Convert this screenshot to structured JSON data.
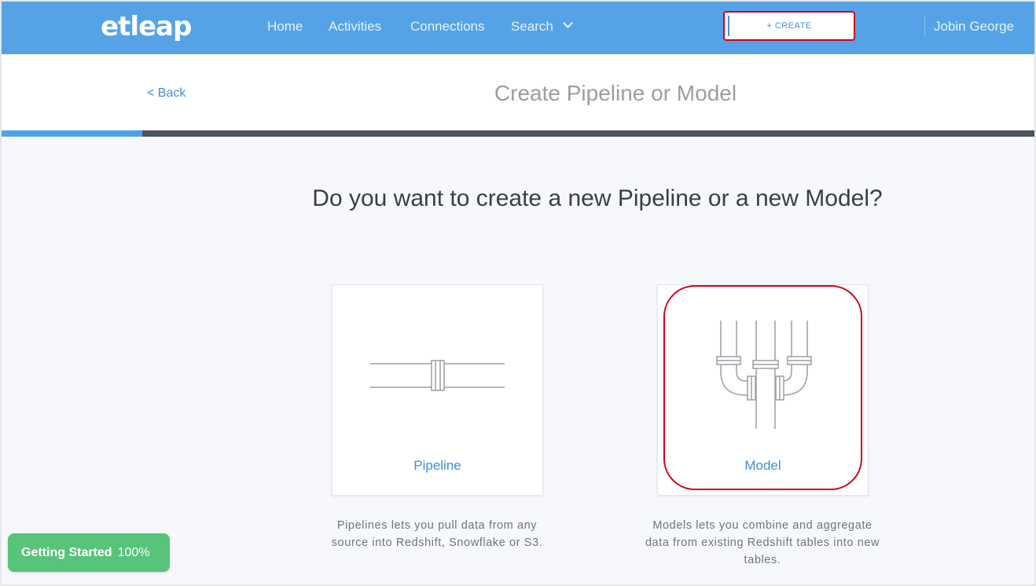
{
  "app": {
    "logo_text": "etleap"
  },
  "nav": {
    "items": [
      {
        "label": "Home"
      },
      {
        "label": "Activities"
      },
      {
        "label": "Connections"
      },
      {
        "label": "Search"
      }
    ],
    "create_label": "+ CREATE",
    "user_name": "Jobin George"
  },
  "header": {
    "back_label": "< Back",
    "title": "Create Pipeline or Model",
    "progress_fraction": 0.136
  },
  "main": {
    "question": "Do you want to create a new Pipeline or a new Model?",
    "options": [
      {
        "label": "Pipeline",
        "icon": "pipeline-icon",
        "description": "Pipelines lets you pull data from any source into Redshift, Snowflake or S3."
      },
      {
        "label": "Model",
        "icon": "model-icon",
        "description": "Models lets you combine and aggregate data from existing Redshift tables into new tables."
      }
    ]
  },
  "getting_started": {
    "label": "Getting Started",
    "percent": "100%"
  },
  "colors": {
    "nav_bg": "#55a3e6",
    "accent": "#3d8fdb",
    "highlight": "#d0021b",
    "getting_started_bg": "#57c479"
  }
}
